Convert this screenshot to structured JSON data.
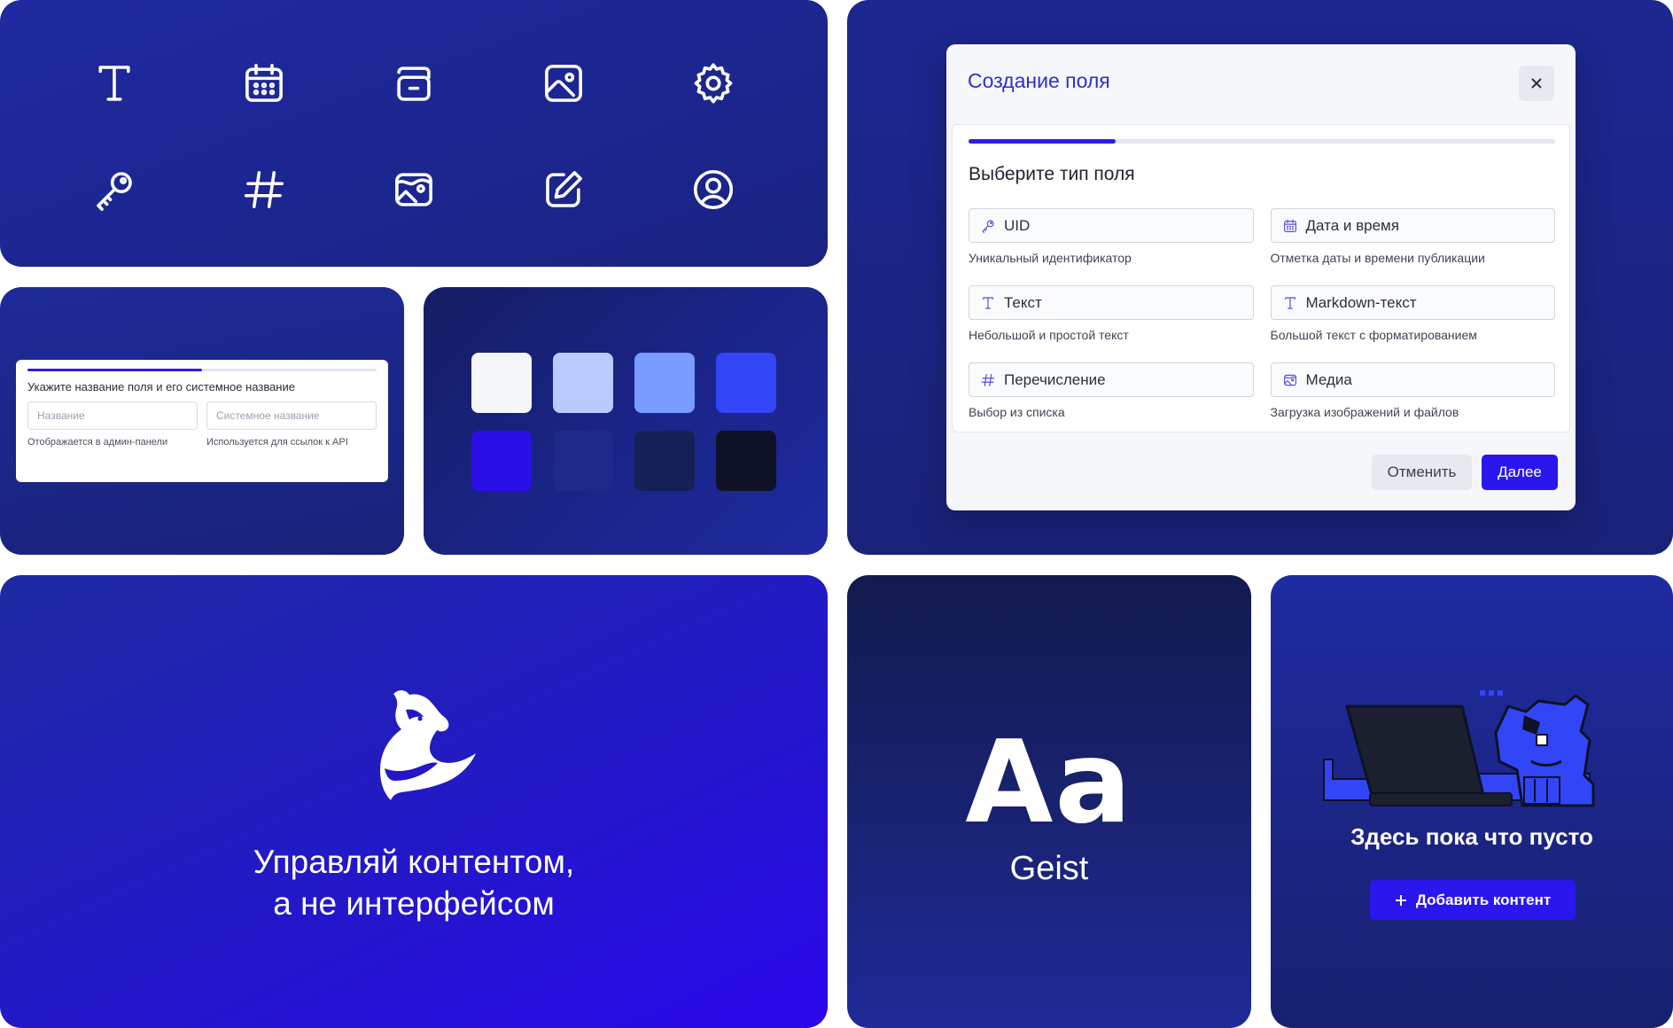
{
  "icons": [
    {
      "name": "text-icon"
    },
    {
      "name": "calendar-icon"
    },
    {
      "name": "folder-icon"
    },
    {
      "name": "image-icon"
    },
    {
      "name": "gear-icon"
    },
    {
      "name": "key-icon"
    },
    {
      "name": "hash-icon"
    },
    {
      "name": "media-icon"
    },
    {
      "name": "edit-icon"
    },
    {
      "name": "user-circle-icon"
    }
  ],
  "field_form": {
    "progress": 0.5,
    "title": "Укажите название поля и его системное название",
    "fields": [
      {
        "placeholder": "Название",
        "hint": "Отображается в админ-панели"
      },
      {
        "placeholder": "Системное название",
        "hint": "Используется для ссылок к API"
      }
    ]
  },
  "palette": {
    "swatches": [
      "#f4f6fa",
      "#bcc9ff",
      "#7a9bff",
      "#3245f7",
      "#2a0fe6",
      "#1d2a8a",
      "#152057",
      "#0d1226"
    ]
  },
  "dialog": {
    "title": "Создание поля",
    "progress": 0.25,
    "heading": "Выберите тип поля",
    "types": [
      {
        "icon": "key-icon",
        "label": "UID",
        "hint": "Уникальный идентификатор"
      },
      {
        "icon": "calendar-icon",
        "label": "Дата и время",
        "hint": "Отметка даты и времени публикации"
      },
      {
        "icon": "text-icon",
        "label": "Текст",
        "hint": "Небольшой и простой текст"
      },
      {
        "icon": "text-icon",
        "label": "Markdown-текст",
        "hint": "Большой текст с форматированием"
      },
      {
        "icon": "hash-icon",
        "label": "Перечисление",
        "hint": "Выбор из списка"
      },
      {
        "icon": "media-icon",
        "label": "Медиа",
        "hint": "Загрузка изображений и файлов"
      }
    ],
    "cancel_label": "Отменить",
    "next_label": "Далее"
  },
  "brand": {
    "tagline_line1": "Управляй контентом,",
    "tagline_line2": "а не интерфейсом"
  },
  "typography": {
    "sample": "Aa",
    "font_name": "Geist"
  },
  "empty_state": {
    "title": "Здесь пока что пусто",
    "button_label": "Добавить контент"
  },
  "colors": {
    "accent": "#2a17ee",
    "dialog_title": "#2e2fd0",
    "card_dark": "#1b2585"
  }
}
